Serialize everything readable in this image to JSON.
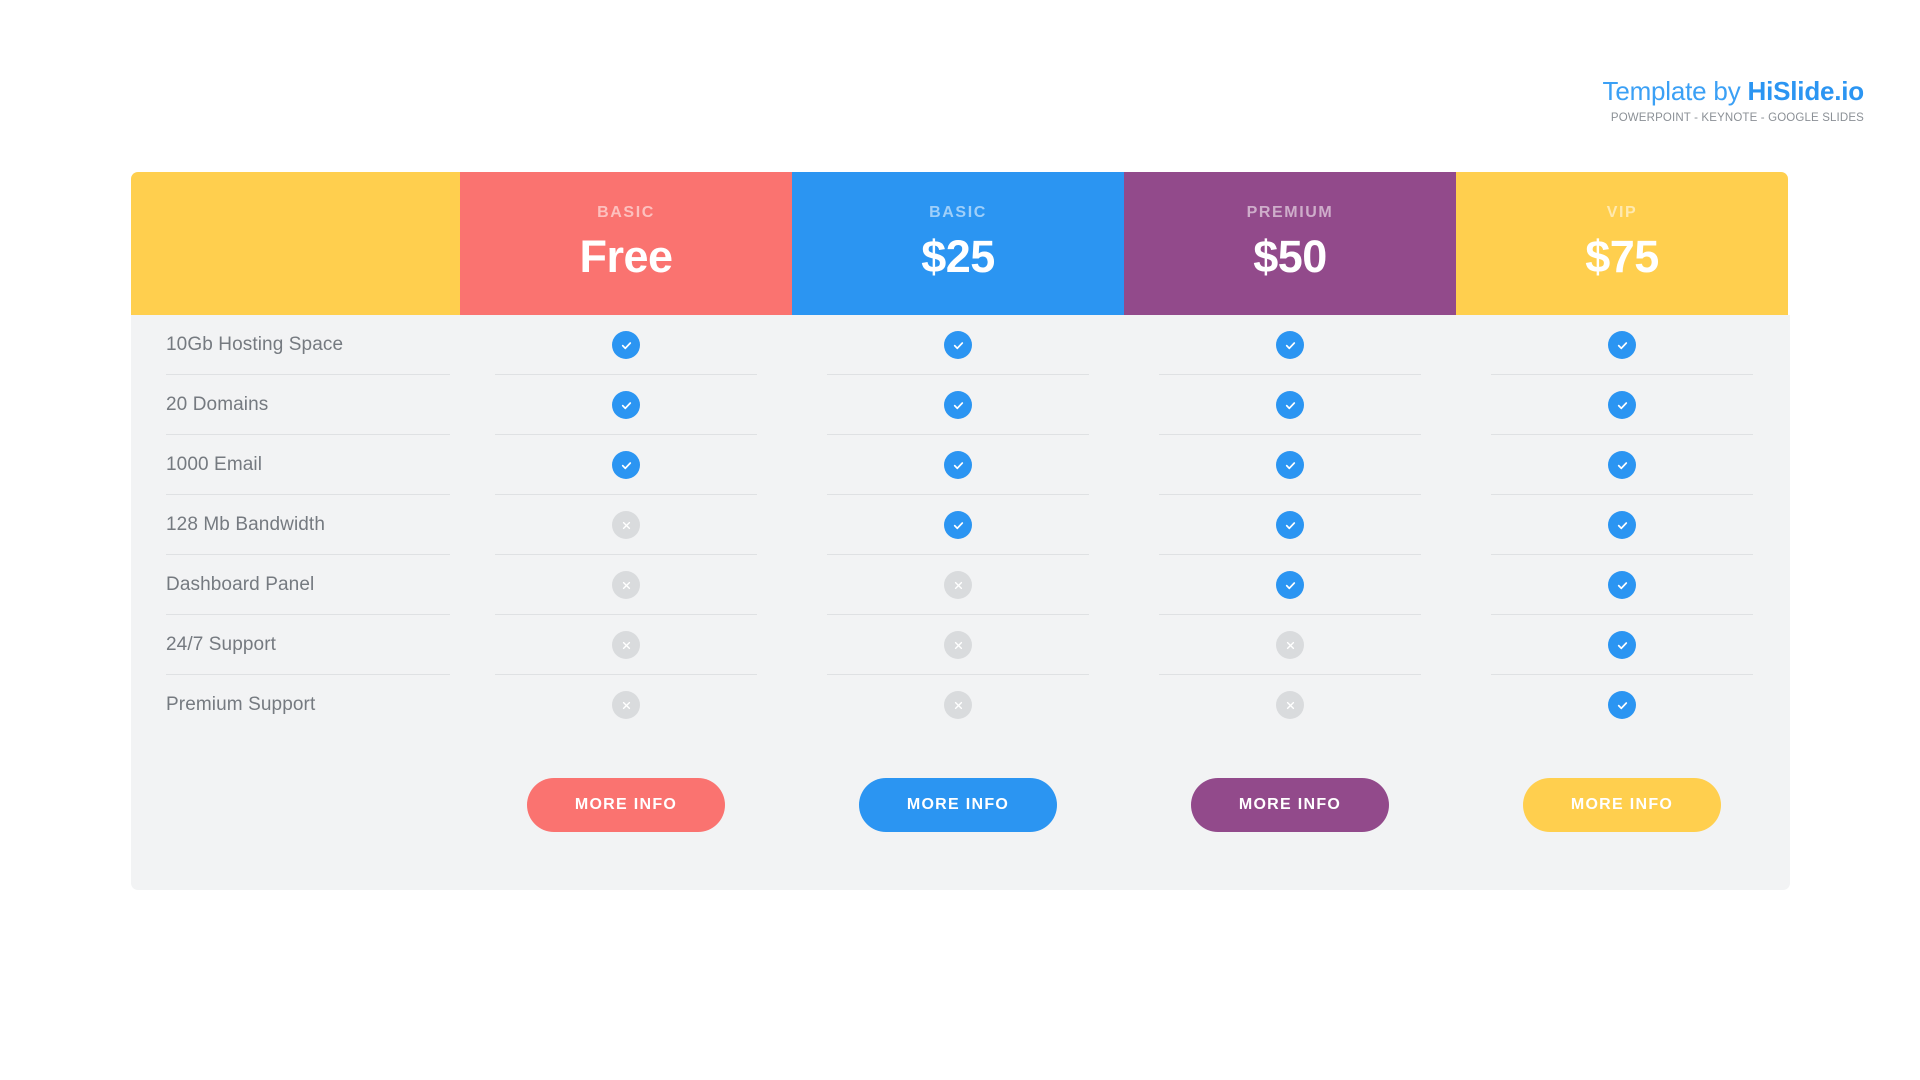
{
  "brand": {
    "title_light": "Template by ",
    "title_bold": "HiSlide.io",
    "subtitle": "POWERPOINT - KEYNOTE - GOOGLE SLIDES"
  },
  "colors": {
    "coral": "#fa7370",
    "blue": "#2b95f2",
    "purple": "#924a8b",
    "yellow": "#ffcf4e",
    "panel": "#f2f3f4",
    "divider": "#dfe1e3",
    "label_text": "#757a80",
    "mark_yes": "#2b95f2",
    "mark_no": "#d9dbdd"
  },
  "plans": [
    {
      "name": "BASIC",
      "price": "Free",
      "color": "#fa7370",
      "button_label": "MORE INFO"
    },
    {
      "name": "BASIC",
      "price": "$25",
      "color": "#2b95f2",
      "button_label": "MORE INFO"
    },
    {
      "name": "PREMIUM",
      "price": "$50",
      "color": "#924a8b",
      "button_label": "MORE INFO"
    },
    {
      "name": "VIP",
      "price": "$75",
      "color": "#ffcf4e",
      "button_label": "MORE INFO"
    }
  ],
  "features": [
    {
      "label": "10Gb Hosting Space",
      "marks": [
        "yes",
        "yes",
        "yes",
        "yes"
      ]
    },
    {
      "label": "20 Domains",
      "marks": [
        "yes",
        "yes",
        "yes",
        "yes"
      ]
    },
    {
      "label": "1000 Email",
      "marks": [
        "yes",
        "yes",
        "yes",
        "yes"
      ]
    },
    {
      "label": "128 Mb Bandwidth",
      "marks": [
        "no",
        "yes",
        "yes",
        "yes"
      ]
    },
    {
      "label": "Dashboard Panel",
      "marks": [
        "no",
        "no",
        "yes",
        "yes"
      ]
    },
    {
      "label": "24/7 Support",
      "marks": [
        "no",
        "no",
        "no",
        "yes"
      ]
    },
    {
      "label": "Premium Support",
      "marks": [
        "no",
        "no",
        "no",
        "yes"
      ]
    }
  ],
  "icons": {
    "yes": "check-icon",
    "no": "cross-icon"
  }
}
